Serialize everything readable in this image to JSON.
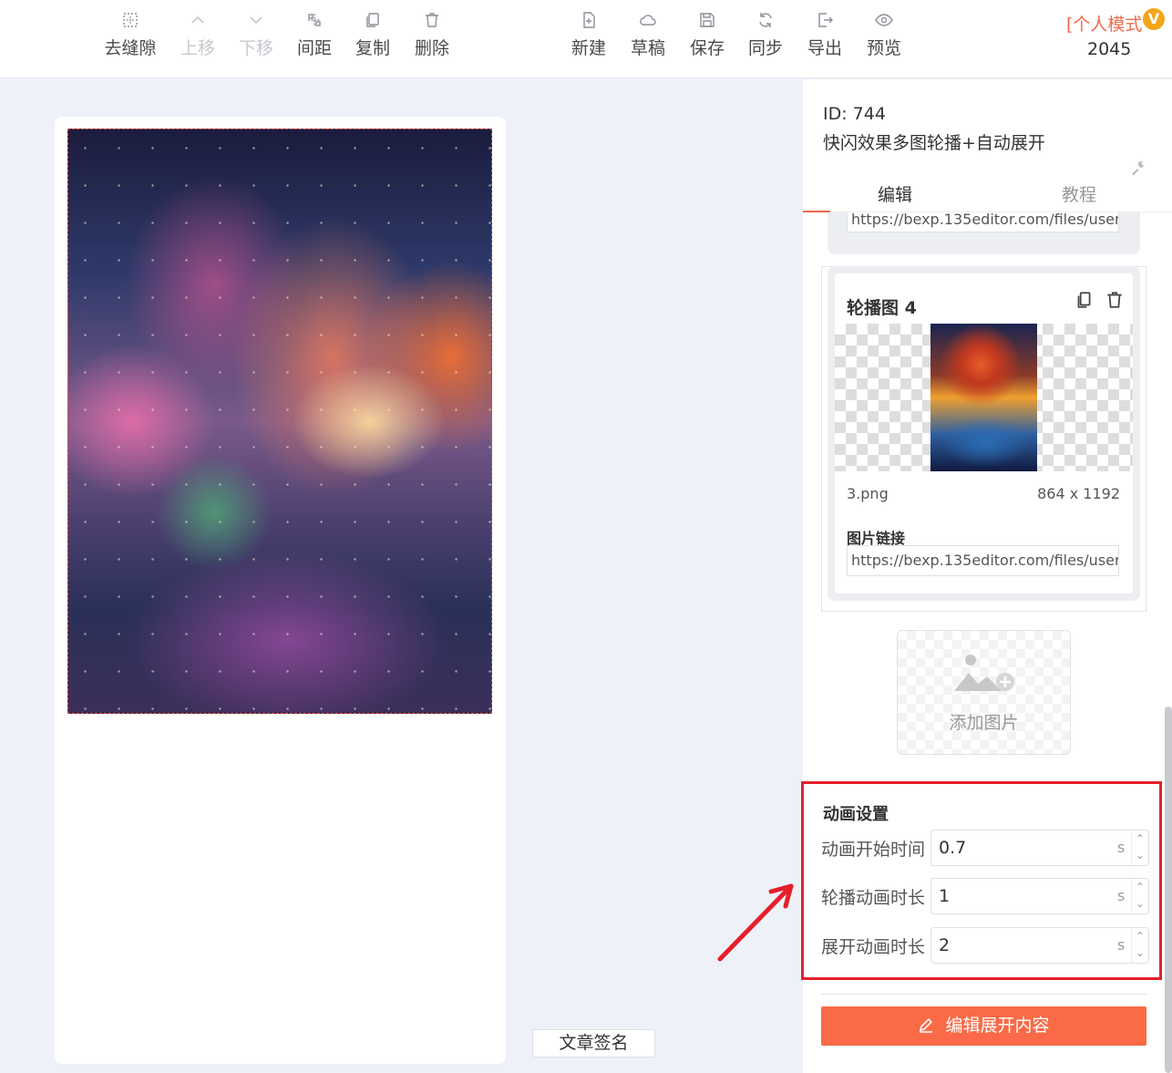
{
  "toolbar": {
    "left": [
      {
        "label": "去缝隙",
        "icon": "grid-dashed-icon",
        "disabled": false
      },
      {
        "label": "上移",
        "icon": "chevron-up-icon",
        "disabled": true
      },
      {
        "label": "下移",
        "icon": "chevron-down-icon",
        "disabled": true
      },
      {
        "label": "间距",
        "icon": "spacing-icon",
        "disabled": false
      },
      {
        "label": "复制",
        "icon": "copy-icon",
        "disabled": false
      },
      {
        "label": "删除",
        "icon": "trash-icon",
        "disabled": false
      }
    ],
    "right": [
      {
        "label": "新建",
        "icon": "new-file-icon"
      },
      {
        "label": "草稿",
        "icon": "cloud-icon"
      },
      {
        "label": "保存",
        "icon": "save-icon"
      },
      {
        "label": "同步",
        "icon": "sync-icon"
      },
      {
        "label": "导出",
        "icon": "export-icon"
      },
      {
        "label": "预览",
        "icon": "eye-icon"
      }
    ],
    "mode_label": "[个人模式",
    "vip_badge": "V",
    "count": "2045"
  },
  "canvas": {
    "signature_button": "文章签名"
  },
  "panel": {
    "id_label": "ID: 744",
    "template_title": "快闪效果多图轮播+自动展开",
    "tabs": [
      "编辑",
      "教程"
    ],
    "prev_card_link": "https://bexp.135editor.com/files/users/",
    "card": {
      "title": "轮播图 4",
      "file_name": "3.png",
      "file_size": "864 x 1192",
      "link_label": "图片链接",
      "link_value": "https://bexp.135editor.com/files/users/"
    },
    "add_image_label": "添加图片",
    "animation": {
      "title": "动画设置",
      "rows": [
        {
          "label": "动画开始时间",
          "value": "0.7",
          "unit": "s"
        },
        {
          "label": "轮播动画时长",
          "value": "1",
          "unit": "s"
        },
        {
          "label": "展开动画时长",
          "value": "2",
          "unit": "s"
        }
      ]
    },
    "edit_button": "编辑展开内容"
  },
  "colors": {
    "accent": "#fa6a46",
    "highlight_box": "#e51f2b",
    "vip_badge": "#f4a619"
  }
}
